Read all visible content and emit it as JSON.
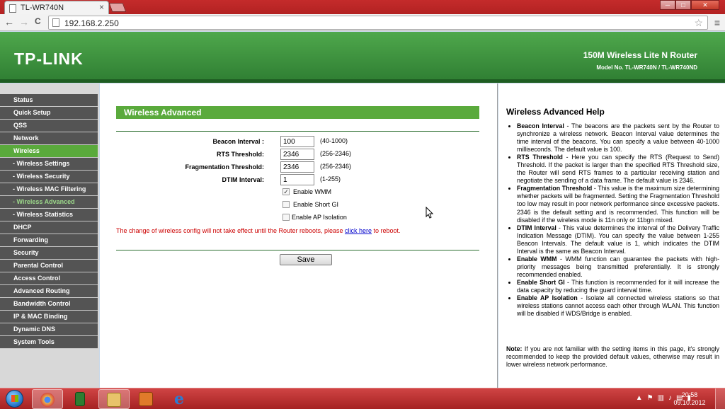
{
  "browser": {
    "tab_title": "TL-WR740N",
    "tab_close": "×",
    "url": "192.168.2.250",
    "window_buttons": [
      "─",
      "□",
      "✕"
    ],
    "back": "←",
    "forward": "→",
    "reload": "C",
    "star": "☆",
    "menu": "≡"
  },
  "header": {
    "logo": "TP-LINK",
    "product": "150M Wireless Lite N Router",
    "model": "Model No. TL-WR740N / TL-WR740ND"
  },
  "sidebar": {
    "items": [
      {
        "label": "Status"
      },
      {
        "label": "Quick Setup"
      },
      {
        "label": "QSS"
      },
      {
        "label": "Network"
      },
      {
        "label": "Wireless"
      },
      {
        "label": "- Wireless Settings"
      },
      {
        "label": "- Wireless Security"
      },
      {
        "label": "- Wireless MAC Filtering"
      },
      {
        "label": "- Wireless Advanced"
      },
      {
        "label": "- Wireless Statistics"
      },
      {
        "label": "DHCP"
      },
      {
        "label": "Forwarding"
      },
      {
        "label": "Security"
      },
      {
        "label": "Parental Control"
      },
      {
        "label": "Access Control"
      },
      {
        "label": "Advanced Routing"
      },
      {
        "label": "Bandwidth Control"
      },
      {
        "label": "IP & MAC Binding"
      },
      {
        "label": "Dynamic DNS"
      },
      {
        "label": "System Tools"
      }
    ]
  },
  "main": {
    "title": "Wireless Advanced",
    "fields": {
      "beacon": {
        "label": "Beacon Interval :",
        "value": "100",
        "range": "(40-1000)"
      },
      "rts": {
        "label": "RTS Threshold:",
        "value": "2346",
        "range": "(256-2346)"
      },
      "frag": {
        "label": "Fragmentation Threshold:",
        "value": "2346",
        "range": "(256-2346)"
      },
      "dtim": {
        "label": "DTIM Interval:",
        "value": "1",
        "range": "(1-255)"
      }
    },
    "checkboxes": {
      "wmm": {
        "label": "Enable WMM",
        "mark": "✓"
      },
      "sgi": {
        "label": "Enable Short GI",
        "mark": ""
      },
      "ap": {
        "label": "Enable AP Isolation",
        "mark": ""
      }
    },
    "note_pre": "The change of wireless config will not take effect until the Router reboots, please ",
    "note_link": "click here",
    "note_post": " to reboot.",
    "save_label": "Save"
  },
  "help": {
    "title": "Wireless Advanced Help",
    "items": [
      {
        "term": "Beacon Interval",
        "text": " - The beacons are the packets sent by the Router to synchronize a wireless network. Beacon Interval value determines the time interval of the beacons. You can specify a value between 40-1000 milliseconds. The default value is 100."
      },
      {
        "term": "RTS Threshold",
        "text": " - Here you can specify the RTS (Request to Send) Threshold. If the packet is larger than the specified RTS Threshold size, the Router will send RTS frames to a particular receiving station and negotiate the sending of a data frame. The default value is 2346."
      },
      {
        "term": "Fragmentation Threshold",
        "text": " - This value is the maximum size determining whether packets will be fragmented. Setting the Fragmentation Threshold too low may result in poor network performance since excessive packets. 2346 is the default setting and is recommended. This function will be disabled if the wireless mode is 11n only or 11bgn mixed."
      },
      {
        "term": "DTIM Interval",
        "text": " - This value determines the interval of the Delivery Traffic Indication Message (DTIM). You can specify the value between 1-255 Beacon Intervals. The default value is 1, which indicates the DTIM Interval is the same as Beacon Interval."
      },
      {
        "term": "Enable WMM",
        "text": " - WMM function can guarantee the packets with high- priority messages being transmitted preferentially. It is strongly recommended enabled."
      },
      {
        "term": "Enable Short GI",
        "text": " - This function is recommended for it will increase the data capacity by reducing the guard interval time."
      },
      {
        "term": "Enable AP Isolation",
        "text": " - Isolate all connected wireless stations so that wireless stations cannot access each other through WLAN. This function will be disabled if WDS/Bridge is enabled."
      }
    ],
    "note_term": "Note:",
    "note_text": " If you are not familiar with the setting items in this page, it's strongly recommended to keep the provided default values, otherwise may result in lower wireless network performance."
  },
  "taskbar": {
    "tray_arrow": "▲",
    "time": "20:58",
    "date": "09.10.2012",
    "colors": {
      "chrome": "#e9b44c",
      "calc": "#2e7d32",
      "folder": "#e8c36a",
      "media": "#e07a2a",
      "ie": "#2b7cd3"
    }
  }
}
